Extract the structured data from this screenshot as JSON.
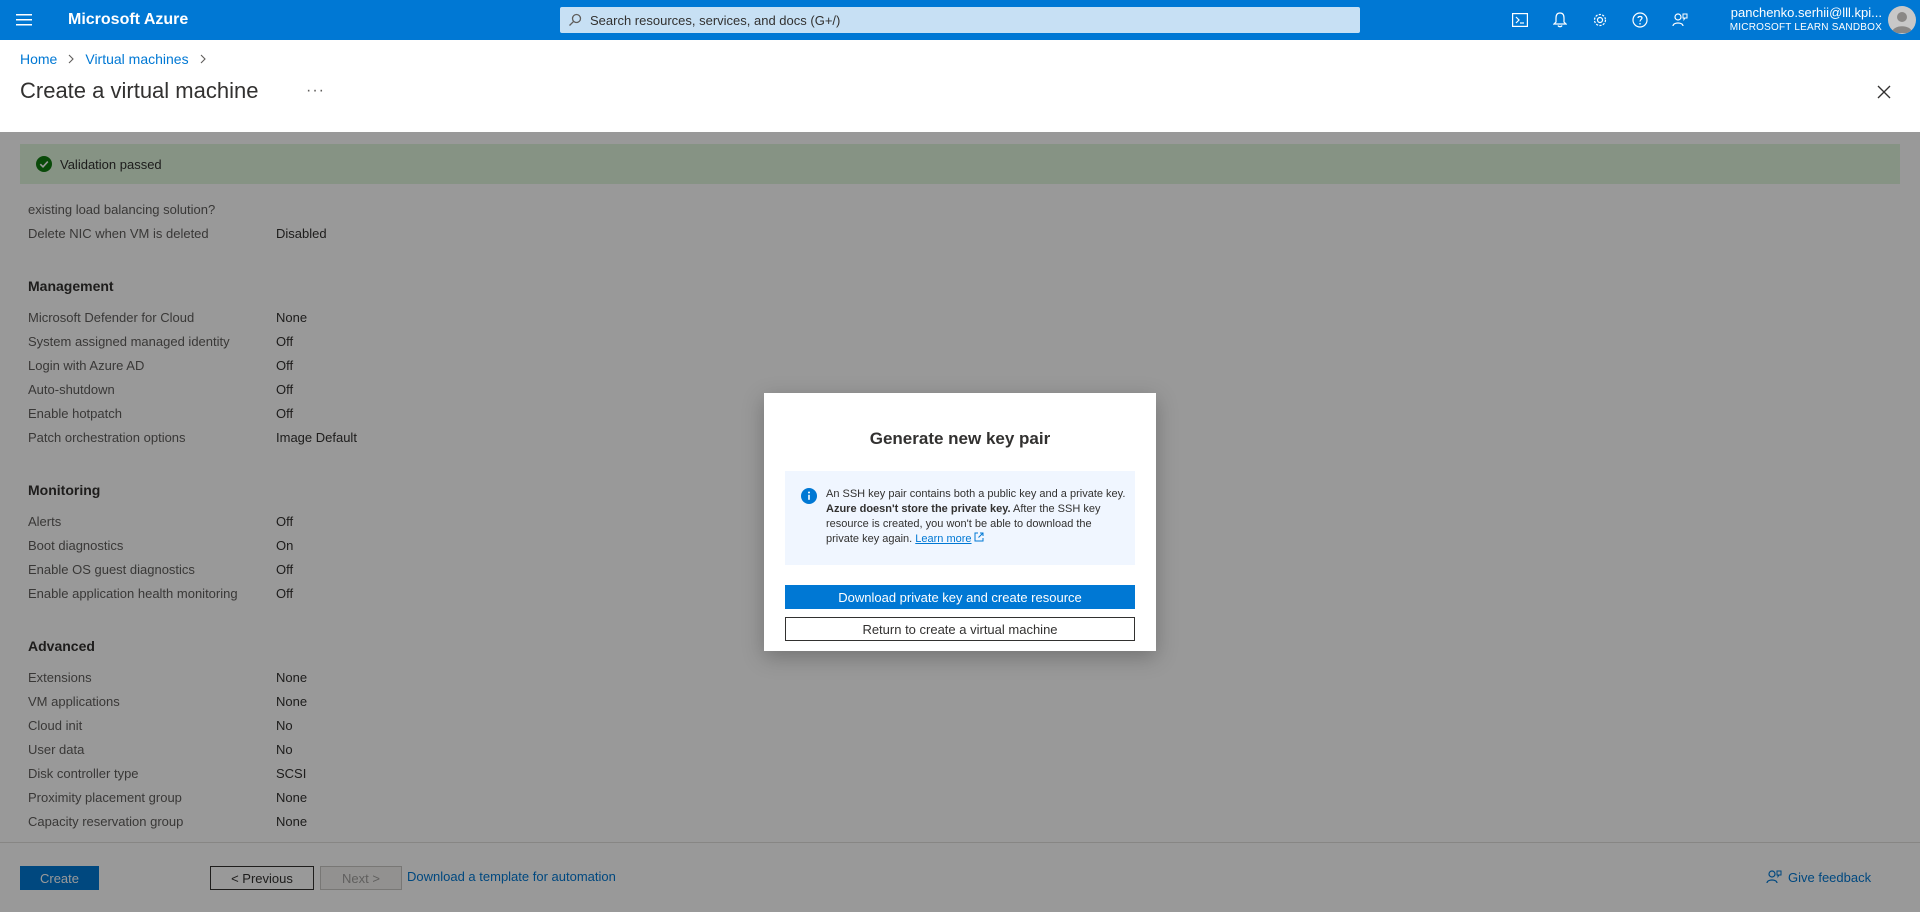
{
  "topbar": {
    "brand": "Microsoft Azure",
    "search_placeholder": "Search resources, services, and docs (G+/)",
    "icons": [
      "cloud-shell-icon",
      "notifications-icon",
      "settings-icon",
      "help-icon",
      "feedback-icon"
    ],
    "user": "panchenko.serhii@lll.kpi...",
    "tenant": "MICROSOFT LEARN SANDBOX"
  },
  "breadcrumb": {
    "home": "Home",
    "vms": "Virtual machines"
  },
  "page": {
    "title": "Create a virtual machine",
    "more": "···"
  },
  "validation": {
    "text": "Validation passed"
  },
  "review": {
    "pre_rows": [
      {
        "label": "existing load balancing solution?",
        "value": ""
      },
      {
        "label": "Delete NIC when VM is deleted",
        "value": "Disabled"
      }
    ],
    "management": {
      "heading": "Management",
      "rows": [
        {
          "label": "Microsoft Defender for Cloud",
          "value": "None"
        },
        {
          "label": "System assigned managed identity",
          "value": "Off"
        },
        {
          "label": "Login with Azure AD",
          "value": "Off"
        },
        {
          "label": "Auto-shutdown",
          "value": "Off"
        },
        {
          "label": "Enable hotpatch",
          "value": "Off"
        },
        {
          "label": "Patch orchestration options",
          "value": "Image Default"
        }
      ]
    },
    "monitoring": {
      "heading": "Monitoring",
      "rows": [
        {
          "label": "Alerts",
          "value": "Off"
        },
        {
          "label": "Boot diagnostics",
          "value": "On"
        },
        {
          "label": "Enable OS guest diagnostics",
          "value": "Off"
        },
        {
          "label": "Enable application health monitoring",
          "value": "Off"
        }
      ]
    },
    "advanced": {
      "heading": "Advanced",
      "rows": [
        {
          "label": "Extensions",
          "value": "None"
        },
        {
          "label": "VM applications",
          "value": "None"
        },
        {
          "label": "Cloud init",
          "value": "No"
        },
        {
          "label": "User data",
          "value": "No"
        },
        {
          "label": "Disk controller type",
          "value": "SCSI"
        },
        {
          "label": "Proximity placement group",
          "value": "None"
        },
        {
          "label": "Capacity reservation group",
          "value": "None"
        }
      ]
    }
  },
  "footer": {
    "create": "Create",
    "previous": "< Previous",
    "next": "Next >",
    "template_link": "Download a template for automation",
    "feedback": "Give feedback"
  },
  "modal": {
    "title": "Generate new key pair",
    "info_part1": "An SSH key pair contains both a public key and a private key.",
    "info_bold": "Azure doesn't store the private key.",
    "info_part2": "After the SSH key resource is created, you won't be able to download the private key again.",
    "learn_more": "Learn more",
    "primary_button": "Download private key and create resource",
    "secondary_button": "Return to create a virtual machine"
  },
  "colors": {
    "accent": "#0078d4",
    "success": "#107c10",
    "validation_bg": "#dff6dd",
    "info_bg": "#f0f6ff"
  }
}
